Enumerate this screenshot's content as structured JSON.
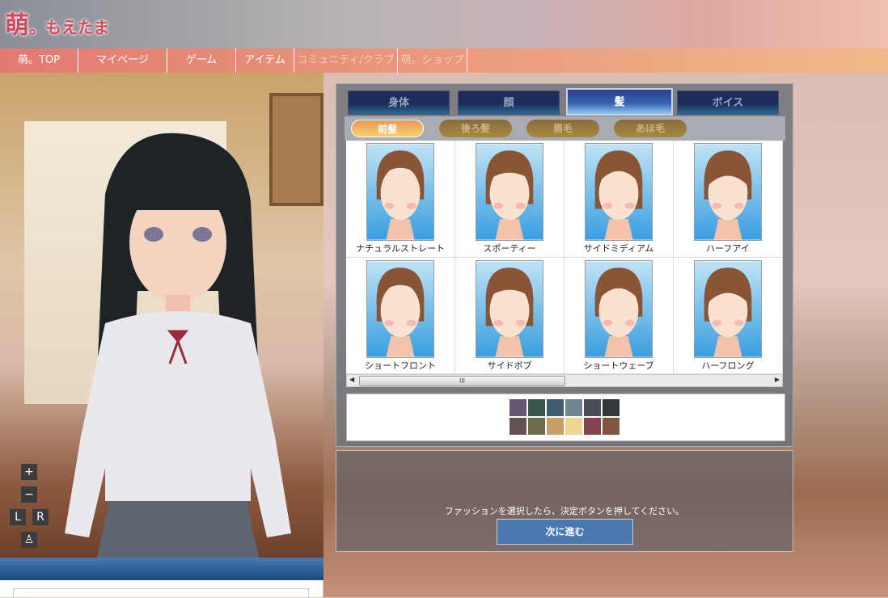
{
  "header": {
    "logo_text": "萌。もえたま"
  },
  "nav": [
    {
      "label": "萌。TOP"
    },
    {
      "label": "マイページ"
    },
    {
      "label": "ゲーム"
    },
    {
      "label": "アイテム"
    },
    {
      "label": "コミュニティ/クラブ"
    },
    {
      "label": "萌。ショップ"
    }
  ],
  "controls": {
    "zoom_in": "+",
    "zoom_out": "−",
    "rotate_left": "L",
    "rotate_right": "R"
  },
  "tabs": [
    {
      "label": "身体"
    },
    {
      "label": "顔"
    },
    {
      "label": "髪",
      "active": true
    },
    {
      "label": "ボイス"
    }
  ],
  "subtabs": [
    {
      "label": "前髪",
      "active": true
    },
    {
      "label": "後ろ髪"
    },
    {
      "label": "眉毛"
    },
    {
      "label": "あほ毛"
    }
  ],
  "hair_styles": [
    {
      "label": "ナチュラルストレート"
    },
    {
      "label": "スポーティー"
    },
    {
      "label": "サイドミディアム"
    },
    {
      "label": "ハーフアイ"
    },
    {
      "label": "ショートフロント"
    },
    {
      "label": "サイドボブ"
    },
    {
      "label": "ショートウェーブ"
    },
    {
      "label": "ハーフロング"
    }
  ],
  "scroll_grip": "III",
  "colors": [
    "#655673",
    "#39574c",
    "#415b70",
    "#718691",
    "#474d55",
    "#35383b",
    "#645352",
    "#6f6b4e",
    "#c99d66",
    "#efd68f",
    "#834450",
    "#7f563f"
  ],
  "footer": {
    "message": "ファッションを選択したら、決定ボタンを押してください。",
    "next_label": "次に進む"
  }
}
